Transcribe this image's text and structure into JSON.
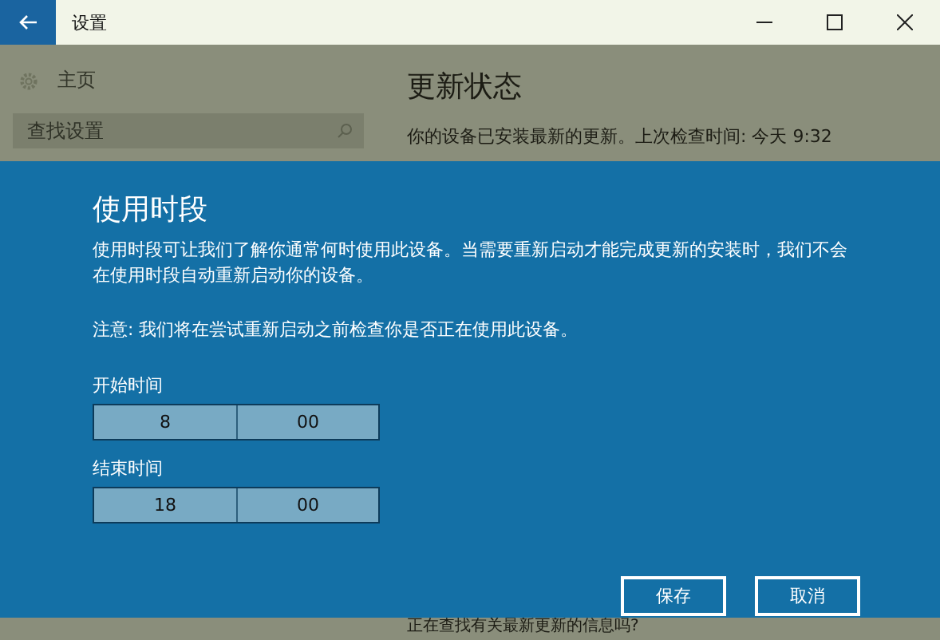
{
  "window": {
    "title": "设置"
  },
  "sidebar": {
    "home": "主页",
    "search": {
      "placeholder": "查找设置"
    }
  },
  "main": {
    "heading": "更新状态",
    "status": "你的设备已安装最新的更新。上次检查时间: 今天 9:32",
    "footer": "正在查找有关最新更新的信息吗?"
  },
  "dialog": {
    "title": "使用时段",
    "description": "使用时段可让我们了解你通常何时使用此设备。当需要重新启动才能完成更新的安装时，我们不会在使用时段自动重新启动你的设备。",
    "note": "注意: 我们将在尝试重新启动之前检查你是否正在使用此设备。",
    "times": [
      {
        "label": "开始时间",
        "hour": "8",
        "minute": "00"
      },
      {
        "label": "结束时间",
        "hour": "18",
        "minute": "00"
      }
    ],
    "buttons": [
      "保存",
      "取消"
    ]
  }
}
